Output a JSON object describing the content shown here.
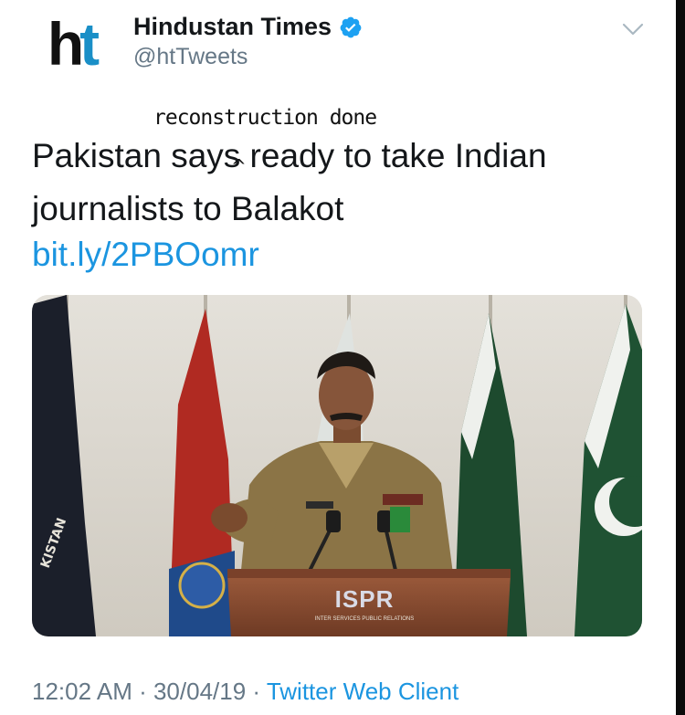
{
  "author": {
    "avatar_text_h": "h",
    "avatar_text_t": "t",
    "display_name": "Hindustan Times",
    "handle": "@htTweets",
    "verified": true
  },
  "annotation": {
    "text": "reconstruction done",
    "caret": "^"
  },
  "tweet": {
    "text": "Pakistan says ready to take Indian journalists to Balakot",
    "link": "bit.ly/2PBOomr"
  },
  "media": {
    "podium_logo": "ISPR",
    "podium_subtitle": "INTER SERVICES PUBLIC RELATIONS",
    "flag_text": "KISTAN"
  },
  "meta": {
    "time": "12:02 AM",
    "separator": " · ",
    "date": "30/04/19",
    "client": "Twitter Web Client"
  },
  "colors": {
    "link": "#1b95e0",
    "secondary_text": "#657786",
    "avatar_accent": "#1a8fc7"
  },
  "icons": [
    "verified-badge-icon",
    "chevron-down-icon"
  ]
}
